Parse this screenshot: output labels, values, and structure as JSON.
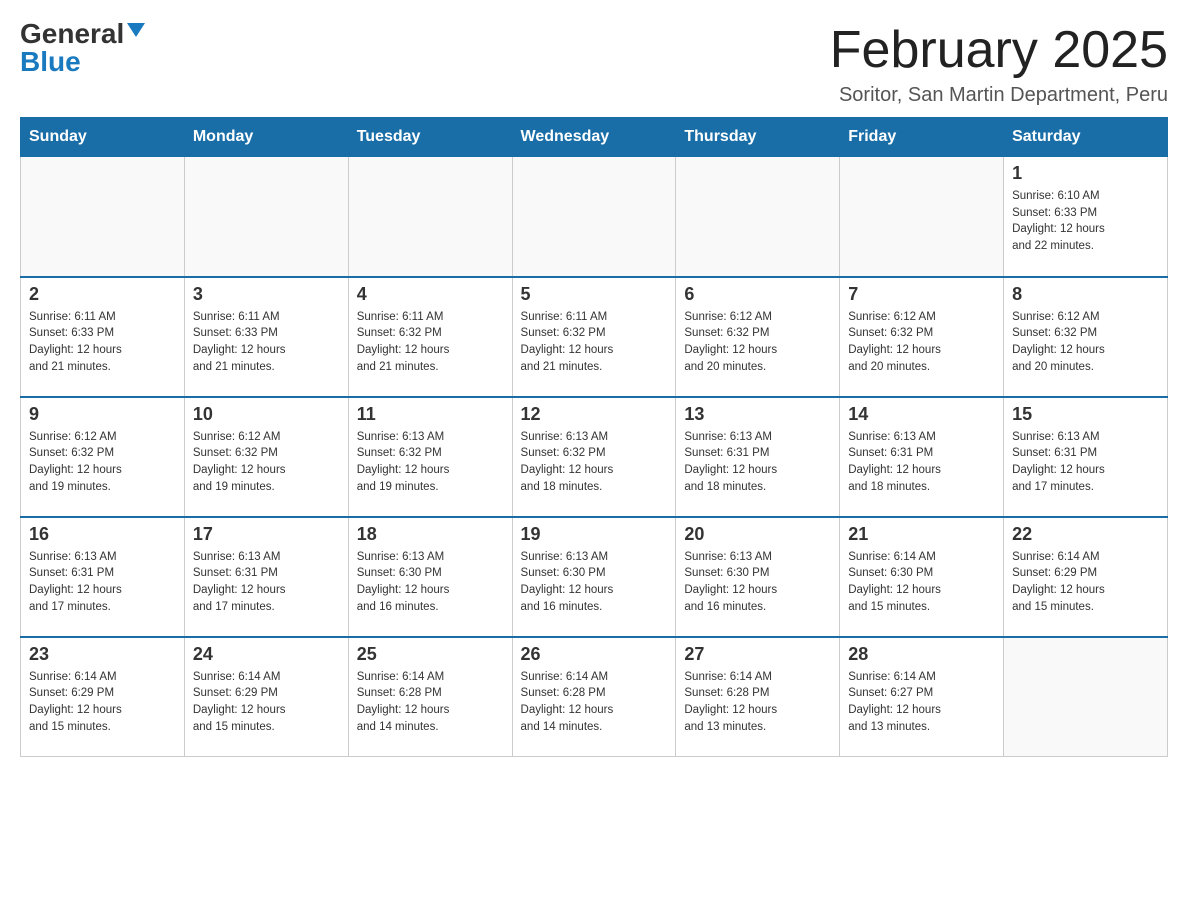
{
  "header": {
    "logo": {
      "general": "General",
      "blue": "Blue",
      "alt": "GeneralBlue logo"
    },
    "title": "February 2025",
    "location": "Soritor, San Martin Department, Peru"
  },
  "calendar": {
    "days_of_week": [
      "Sunday",
      "Monday",
      "Tuesday",
      "Wednesday",
      "Thursday",
      "Friday",
      "Saturday"
    ],
    "weeks": [
      [
        {
          "day": "",
          "info": ""
        },
        {
          "day": "",
          "info": ""
        },
        {
          "day": "",
          "info": ""
        },
        {
          "day": "",
          "info": ""
        },
        {
          "day": "",
          "info": ""
        },
        {
          "day": "",
          "info": ""
        },
        {
          "day": "1",
          "info": "Sunrise: 6:10 AM\nSunset: 6:33 PM\nDaylight: 12 hours\nand 22 minutes."
        }
      ],
      [
        {
          "day": "2",
          "info": "Sunrise: 6:11 AM\nSunset: 6:33 PM\nDaylight: 12 hours\nand 21 minutes."
        },
        {
          "day": "3",
          "info": "Sunrise: 6:11 AM\nSunset: 6:33 PM\nDaylight: 12 hours\nand 21 minutes."
        },
        {
          "day": "4",
          "info": "Sunrise: 6:11 AM\nSunset: 6:32 PM\nDaylight: 12 hours\nand 21 minutes."
        },
        {
          "day": "5",
          "info": "Sunrise: 6:11 AM\nSunset: 6:32 PM\nDaylight: 12 hours\nand 21 minutes."
        },
        {
          "day": "6",
          "info": "Sunrise: 6:12 AM\nSunset: 6:32 PM\nDaylight: 12 hours\nand 20 minutes."
        },
        {
          "day": "7",
          "info": "Sunrise: 6:12 AM\nSunset: 6:32 PM\nDaylight: 12 hours\nand 20 minutes."
        },
        {
          "day": "8",
          "info": "Sunrise: 6:12 AM\nSunset: 6:32 PM\nDaylight: 12 hours\nand 20 minutes."
        }
      ],
      [
        {
          "day": "9",
          "info": "Sunrise: 6:12 AM\nSunset: 6:32 PM\nDaylight: 12 hours\nand 19 minutes."
        },
        {
          "day": "10",
          "info": "Sunrise: 6:12 AM\nSunset: 6:32 PM\nDaylight: 12 hours\nand 19 minutes."
        },
        {
          "day": "11",
          "info": "Sunrise: 6:13 AM\nSunset: 6:32 PM\nDaylight: 12 hours\nand 19 minutes."
        },
        {
          "day": "12",
          "info": "Sunrise: 6:13 AM\nSunset: 6:32 PM\nDaylight: 12 hours\nand 18 minutes."
        },
        {
          "day": "13",
          "info": "Sunrise: 6:13 AM\nSunset: 6:31 PM\nDaylight: 12 hours\nand 18 minutes."
        },
        {
          "day": "14",
          "info": "Sunrise: 6:13 AM\nSunset: 6:31 PM\nDaylight: 12 hours\nand 18 minutes."
        },
        {
          "day": "15",
          "info": "Sunrise: 6:13 AM\nSunset: 6:31 PM\nDaylight: 12 hours\nand 17 minutes."
        }
      ],
      [
        {
          "day": "16",
          "info": "Sunrise: 6:13 AM\nSunset: 6:31 PM\nDaylight: 12 hours\nand 17 minutes."
        },
        {
          "day": "17",
          "info": "Sunrise: 6:13 AM\nSunset: 6:31 PM\nDaylight: 12 hours\nand 17 minutes."
        },
        {
          "day": "18",
          "info": "Sunrise: 6:13 AM\nSunset: 6:30 PM\nDaylight: 12 hours\nand 16 minutes."
        },
        {
          "day": "19",
          "info": "Sunrise: 6:13 AM\nSunset: 6:30 PM\nDaylight: 12 hours\nand 16 minutes."
        },
        {
          "day": "20",
          "info": "Sunrise: 6:13 AM\nSunset: 6:30 PM\nDaylight: 12 hours\nand 16 minutes."
        },
        {
          "day": "21",
          "info": "Sunrise: 6:14 AM\nSunset: 6:30 PM\nDaylight: 12 hours\nand 15 minutes."
        },
        {
          "day": "22",
          "info": "Sunrise: 6:14 AM\nSunset: 6:29 PM\nDaylight: 12 hours\nand 15 minutes."
        }
      ],
      [
        {
          "day": "23",
          "info": "Sunrise: 6:14 AM\nSunset: 6:29 PM\nDaylight: 12 hours\nand 15 minutes."
        },
        {
          "day": "24",
          "info": "Sunrise: 6:14 AM\nSunset: 6:29 PM\nDaylight: 12 hours\nand 15 minutes."
        },
        {
          "day": "25",
          "info": "Sunrise: 6:14 AM\nSunset: 6:28 PM\nDaylight: 12 hours\nand 14 minutes."
        },
        {
          "day": "26",
          "info": "Sunrise: 6:14 AM\nSunset: 6:28 PM\nDaylight: 12 hours\nand 14 minutes."
        },
        {
          "day": "27",
          "info": "Sunrise: 6:14 AM\nSunset: 6:28 PM\nDaylight: 12 hours\nand 13 minutes."
        },
        {
          "day": "28",
          "info": "Sunrise: 6:14 AM\nSunset: 6:27 PM\nDaylight: 12 hours\nand 13 minutes."
        },
        {
          "day": "",
          "info": ""
        }
      ]
    ]
  }
}
